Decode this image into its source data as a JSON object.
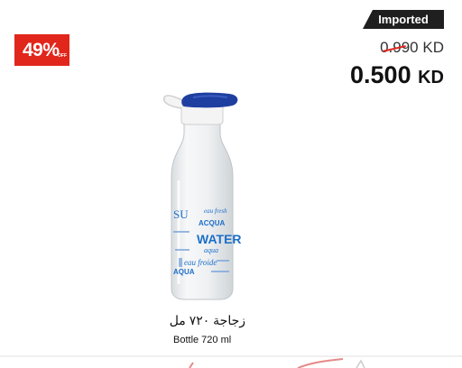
{
  "badge": {
    "label": "Imported"
  },
  "discount": {
    "percent": "49%",
    "off": "OFF"
  },
  "price": {
    "old_value": "0.990",
    "old_currency": "KD",
    "new_value": "0.500",
    "new_currency": "KD"
  },
  "product": {
    "name_ar": "زجاجة ٧٢٠ مل",
    "name_en": "Bottle 720 ml",
    "image_icon": "glass-water-bottle-icon",
    "label_text": {
      "line1": "SU",
      "line2": "eau fresh",
      "line3": "ACQUA",
      "line4": "WATER",
      "line5": "aqua",
      "line6": "eau froide",
      "line7": "AQUA"
    }
  },
  "colors": {
    "discount_red": "#e1261c",
    "badge_black": "#1f1f1f",
    "cap_blue": "#1f3fa0",
    "label_blue": "#1d6fc9"
  }
}
